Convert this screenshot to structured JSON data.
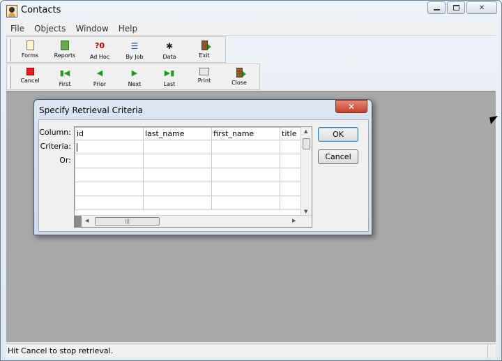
{
  "window": {
    "title": "Contacts",
    "buttons": {
      "minimize": "▭",
      "maximize": "☐",
      "close": "✕"
    }
  },
  "menu": [
    "File",
    "Objects",
    "Window",
    "Help"
  ],
  "toolbar1": [
    {
      "label": "Forms",
      "icon": "forms-icon"
    },
    {
      "label": "Reports",
      "icon": "reports-icon"
    },
    {
      "label": "Ad Hoc",
      "icon": "adhoc-icon"
    },
    {
      "label": "By Job",
      "icon": "byjob-icon"
    },
    {
      "label": "Data",
      "icon": "data-icon"
    },
    {
      "label": "Exit",
      "icon": "exit-door-icon"
    }
  ],
  "toolbar2": [
    {
      "label": "Cancel",
      "icon": "stop-icon"
    },
    {
      "label": "First",
      "icon": "first-icon"
    },
    {
      "label": "Prior",
      "icon": "prior-icon"
    },
    {
      "label": "Next",
      "icon": "next-icon"
    },
    {
      "label": "Last",
      "icon": "last-icon"
    },
    {
      "label": "Print",
      "icon": "printer-icon"
    },
    {
      "label": "Close",
      "icon": "close-door-icon"
    }
  ],
  "dialog": {
    "title": "Specify Retrieval Criteria",
    "close_glyph": "✕",
    "row_labels": {
      "column": "Column:",
      "criteria": "Criteria:",
      "or": "Or:"
    },
    "columns": [
      "id",
      "last_name",
      "first_name",
      "title"
    ],
    "ok_label": "OK",
    "cancel_label": "Cancel"
  },
  "status": {
    "text": "Hit Cancel to stop retrieval."
  }
}
